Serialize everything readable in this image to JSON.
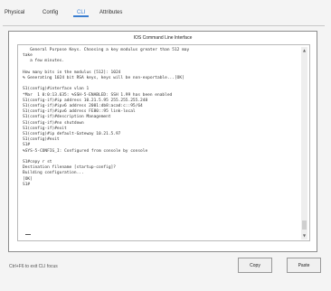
{
  "tabs": [
    {
      "label": "Physical"
    },
    {
      "label": "Config"
    },
    {
      "label": "CLI"
    },
    {
      "label": "Attributes"
    }
  ],
  "panel": {
    "title": "IOS Command Line Interface"
  },
  "console": {
    "lines": [
      "   General Purpose Keys. Choosing a key modulus greater than 512 may",
      "take",
      "   a few minutes.",
      "",
      "How many bits in the modulus [512]: 1024",
      "% Generating 1024 bit RSA keys, keys will be non-exportable...[OK]",
      "",
      "S1(config)#interface vlan 1",
      "*Mar  1 0:0:13.635: %SSH-5-ENABLED: SSH 1.99 has been enabled",
      "S1(config-if)#ip address 10.21.5.95 255.255.255.248",
      "S1(config-if)#ipv6 address 2001:db8:acad:c::95/64",
      "S1(config-if)#ipv6 address FE80::95 link-local",
      "S1(config-if)#description Management",
      "S1(config-if)#no shutdown",
      "S1(config-if)#exit",
      "S1(config)#ip default-Gateway 10.21.5.97",
      "S1(config)#exit",
      "S1#",
      "%SYS-5-CONFIG_I: Configured from console by console",
      "",
      "S1#copy r st",
      "Destination filename [startup-config]?",
      "Building configuration...",
      "[OK]",
      "S1#"
    ]
  },
  "footer": {
    "hint": "Ctrl+F6 to exit CLI focus"
  },
  "buttons": {
    "copy": "Copy",
    "paste": "Paste"
  }
}
